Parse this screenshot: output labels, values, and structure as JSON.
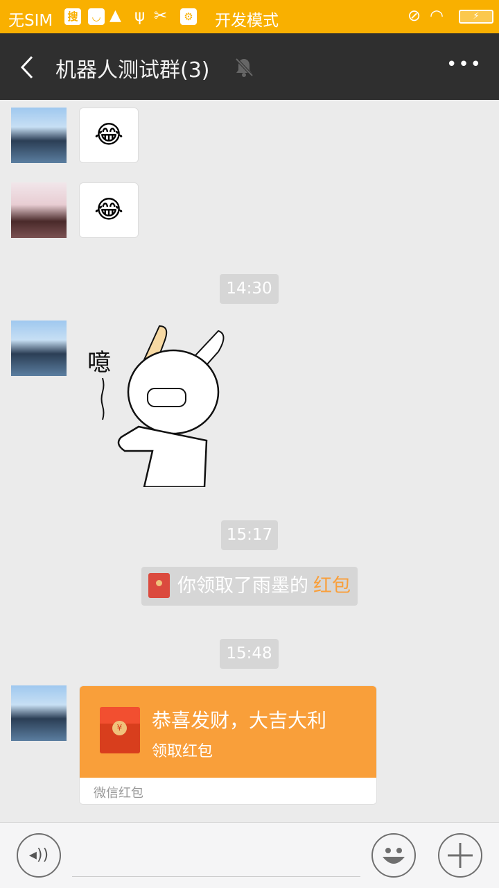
{
  "status_bar": {
    "carrier": "无SIM",
    "mode": "开发模式",
    "icons": [
      "search-app-icon",
      "shop-icon",
      "android-icon",
      "usb-icon",
      "tools-icon",
      "usb-debug-icon",
      "mute-icon",
      "wifi-icon",
      "battery-charging-icon"
    ]
  },
  "header": {
    "title": "机器人测试群(3)",
    "muted": true
  },
  "messages": [
    {
      "type": "emoji",
      "content": "😂"
    },
    {
      "type": "emoji",
      "content": "😂"
    },
    {
      "type": "time",
      "text": "14:30"
    },
    {
      "type": "sticker",
      "text": "噫"
    },
    {
      "type": "time",
      "text": "15:17"
    },
    {
      "type": "system",
      "text": "你领取了雨墨的",
      "link": "红包"
    },
    {
      "type": "time",
      "text": "15:48"
    },
    {
      "type": "red_packet",
      "title": "恭喜发财，大吉大利",
      "action": "领取红包",
      "footer": "微信红包"
    }
  ],
  "colors": {
    "status": "#f9b000",
    "header": "#2f2f2f",
    "red_packet": "#f99f3a",
    "link": "#f99f3a"
  }
}
